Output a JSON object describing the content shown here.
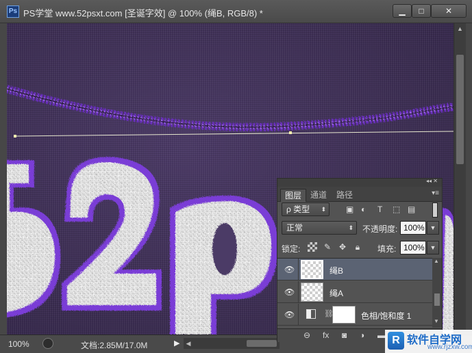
{
  "window": {
    "title": "PS学堂 www.52psxt.com [圣诞字效] @ 100% (绳B, RGB/8) *",
    "logo": "Ps",
    "minimize_icon": "▁",
    "maximize_icon": "□",
    "close_icon": "✕"
  },
  "status": {
    "zoom": "100%",
    "doc_size": "文档:2.85M/17.0M",
    "arrow": "▶"
  },
  "layers_panel": {
    "tabs": [
      "图层",
      "通道",
      "路径"
    ],
    "active_tab": "图层",
    "filter_kind": "ρ 类型",
    "blend_mode": "正常",
    "opacity_label": "不透明度:",
    "opacity_value": "100%",
    "lock_label": "锁定:",
    "fill_label": "填充:",
    "fill_value": "100%",
    "layers": [
      {
        "name": "绳B",
        "selected": true,
        "visible": true
      },
      {
        "name": "绳A",
        "selected": false,
        "visible": true
      },
      {
        "name": "色相/饱和度 1",
        "selected": false,
        "visible": true,
        "type": "adjustment"
      }
    ]
  },
  "canvas": {
    "artwork_text": "52p"
  },
  "watermark": {
    "logo": "R",
    "title": "软件自学网",
    "url": "www.rjzxw.com"
  },
  "colors": {
    "background": "#3a2c50",
    "rope": "#8a4de0",
    "selection": "#5b6373"
  }
}
